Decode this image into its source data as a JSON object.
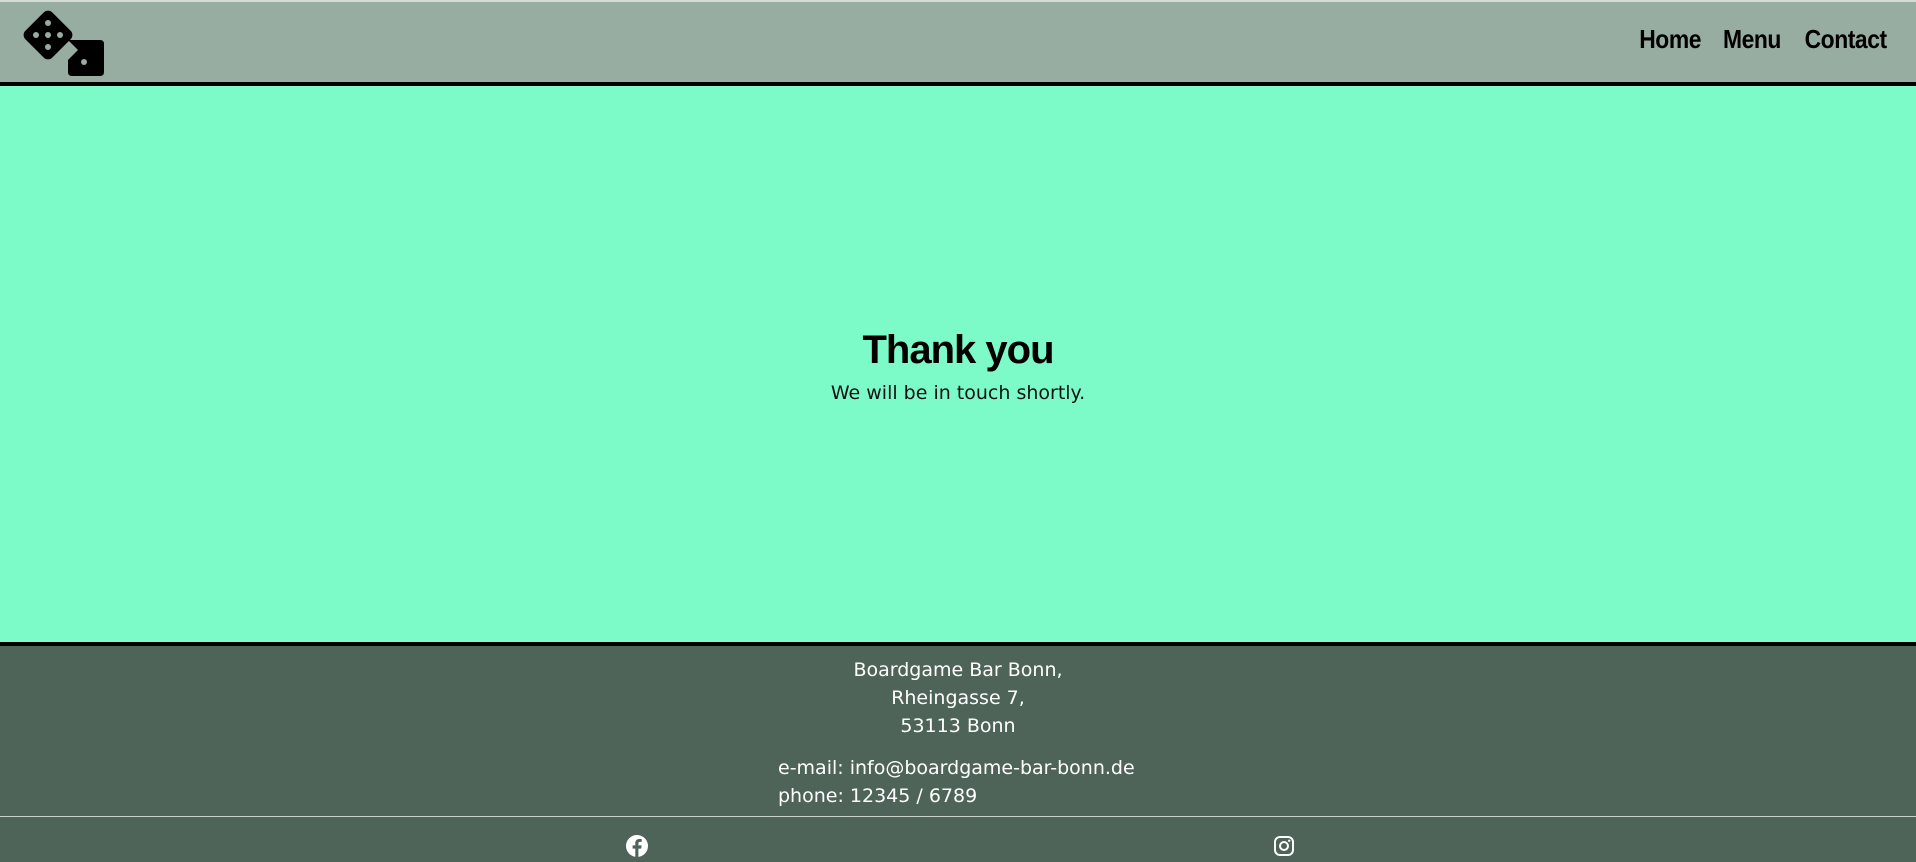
{
  "header": {
    "logo_icon": "dice-icon",
    "nav": [
      {
        "label": "Home"
      },
      {
        "label": "Menu"
      },
      {
        "label": "Contact"
      }
    ]
  },
  "main": {
    "title": "Thank you",
    "subtitle": "We will be in touch shortly."
  },
  "footer": {
    "address": {
      "line1": "Boardgame Bar Bonn,",
      "line2": "Rheingasse 7,",
      "line3": "53113 Bonn"
    },
    "contact": {
      "email": "e-mail: info@boardgame-bar-bonn.de",
      "phone": "phone: 12345 / 6789"
    },
    "social": [
      {
        "icon": "facebook-icon"
      },
      {
        "icon": "instagram-icon"
      }
    ]
  },
  "colors": {
    "header_bg": "#98ADA2",
    "main_bg": "#7CFBC8",
    "footer_bg": "#4F6459",
    "text_dark": "#000000",
    "text_light": "#FFFFFF"
  }
}
